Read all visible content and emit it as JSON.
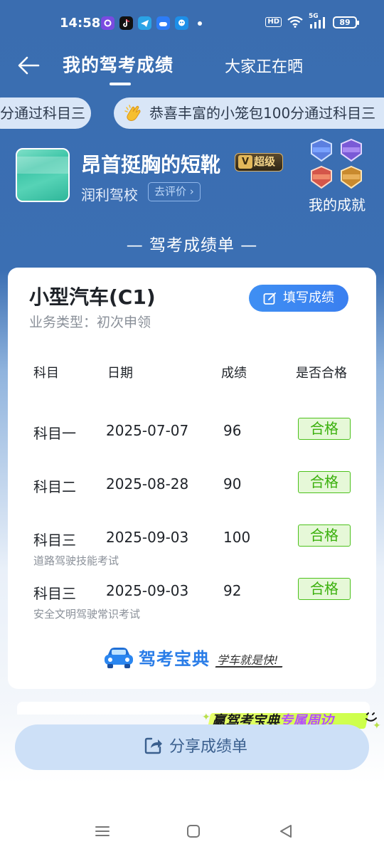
{
  "status_bar": {
    "time": "14:58",
    "apps": [
      "camera-app-icon",
      "tiktok-app-icon",
      "telegram-app-icon",
      "cloud-app-icon",
      "assistant-app-icon"
    ],
    "hd": "HD",
    "network": "5G",
    "battery": "89"
  },
  "nav": {
    "title": "我的驾考成绩",
    "tab2": "大家正在晒"
  },
  "ticker": {
    "item1": "分通过科目三",
    "item2": "恭喜丰富的小笼包100分通过科目三"
  },
  "profile": {
    "name": "昂首挺胸的短靴",
    "vip_label": "超级",
    "vip_letter": "V",
    "school": "润利驾校",
    "review_label": "去评价",
    "achievements_label": "我的成就"
  },
  "section_title": "— 驾考成绩单 —",
  "card": {
    "car_type": "小型汽车(C1)",
    "business_type": "业务类型：初次申领",
    "fill_button": "填写成绩",
    "headers": {
      "subject": "科目",
      "date": "日期",
      "score": "成绩",
      "passed": "是否合格"
    },
    "rows": [
      {
        "subject": "科目一",
        "date": "2025-07-07",
        "score": "96",
        "status": "合格",
        "sub": ""
      },
      {
        "subject": "科目二",
        "date": "2025-08-28",
        "score": "90",
        "status": "合格",
        "sub": ""
      },
      {
        "subject": "科目三",
        "date": "2025-09-03",
        "score": "100",
        "status": "合格",
        "sub": "道路驾驶技能考试"
      },
      {
        "subject": "科目三",
        "date": "2025-09-03",
        "score": "92",
        "status": "合格",
        "sub": "安全文明驾驶常识考试"
      }
    ],
    "brand_name": "驾考宝典",
    "brand_slogan": "学车就是快!"
  },
  "promo": {
    "part1": "赢驾考宝典",
    "part2": "专属周边"
  },
  "share_button": "分享成绩单",
  "colors": {
    "header_blue": "#3a6db0",
    "button_blue": "#3f8ff3",
    "pass_green": "#3ab00c"
  }
}
